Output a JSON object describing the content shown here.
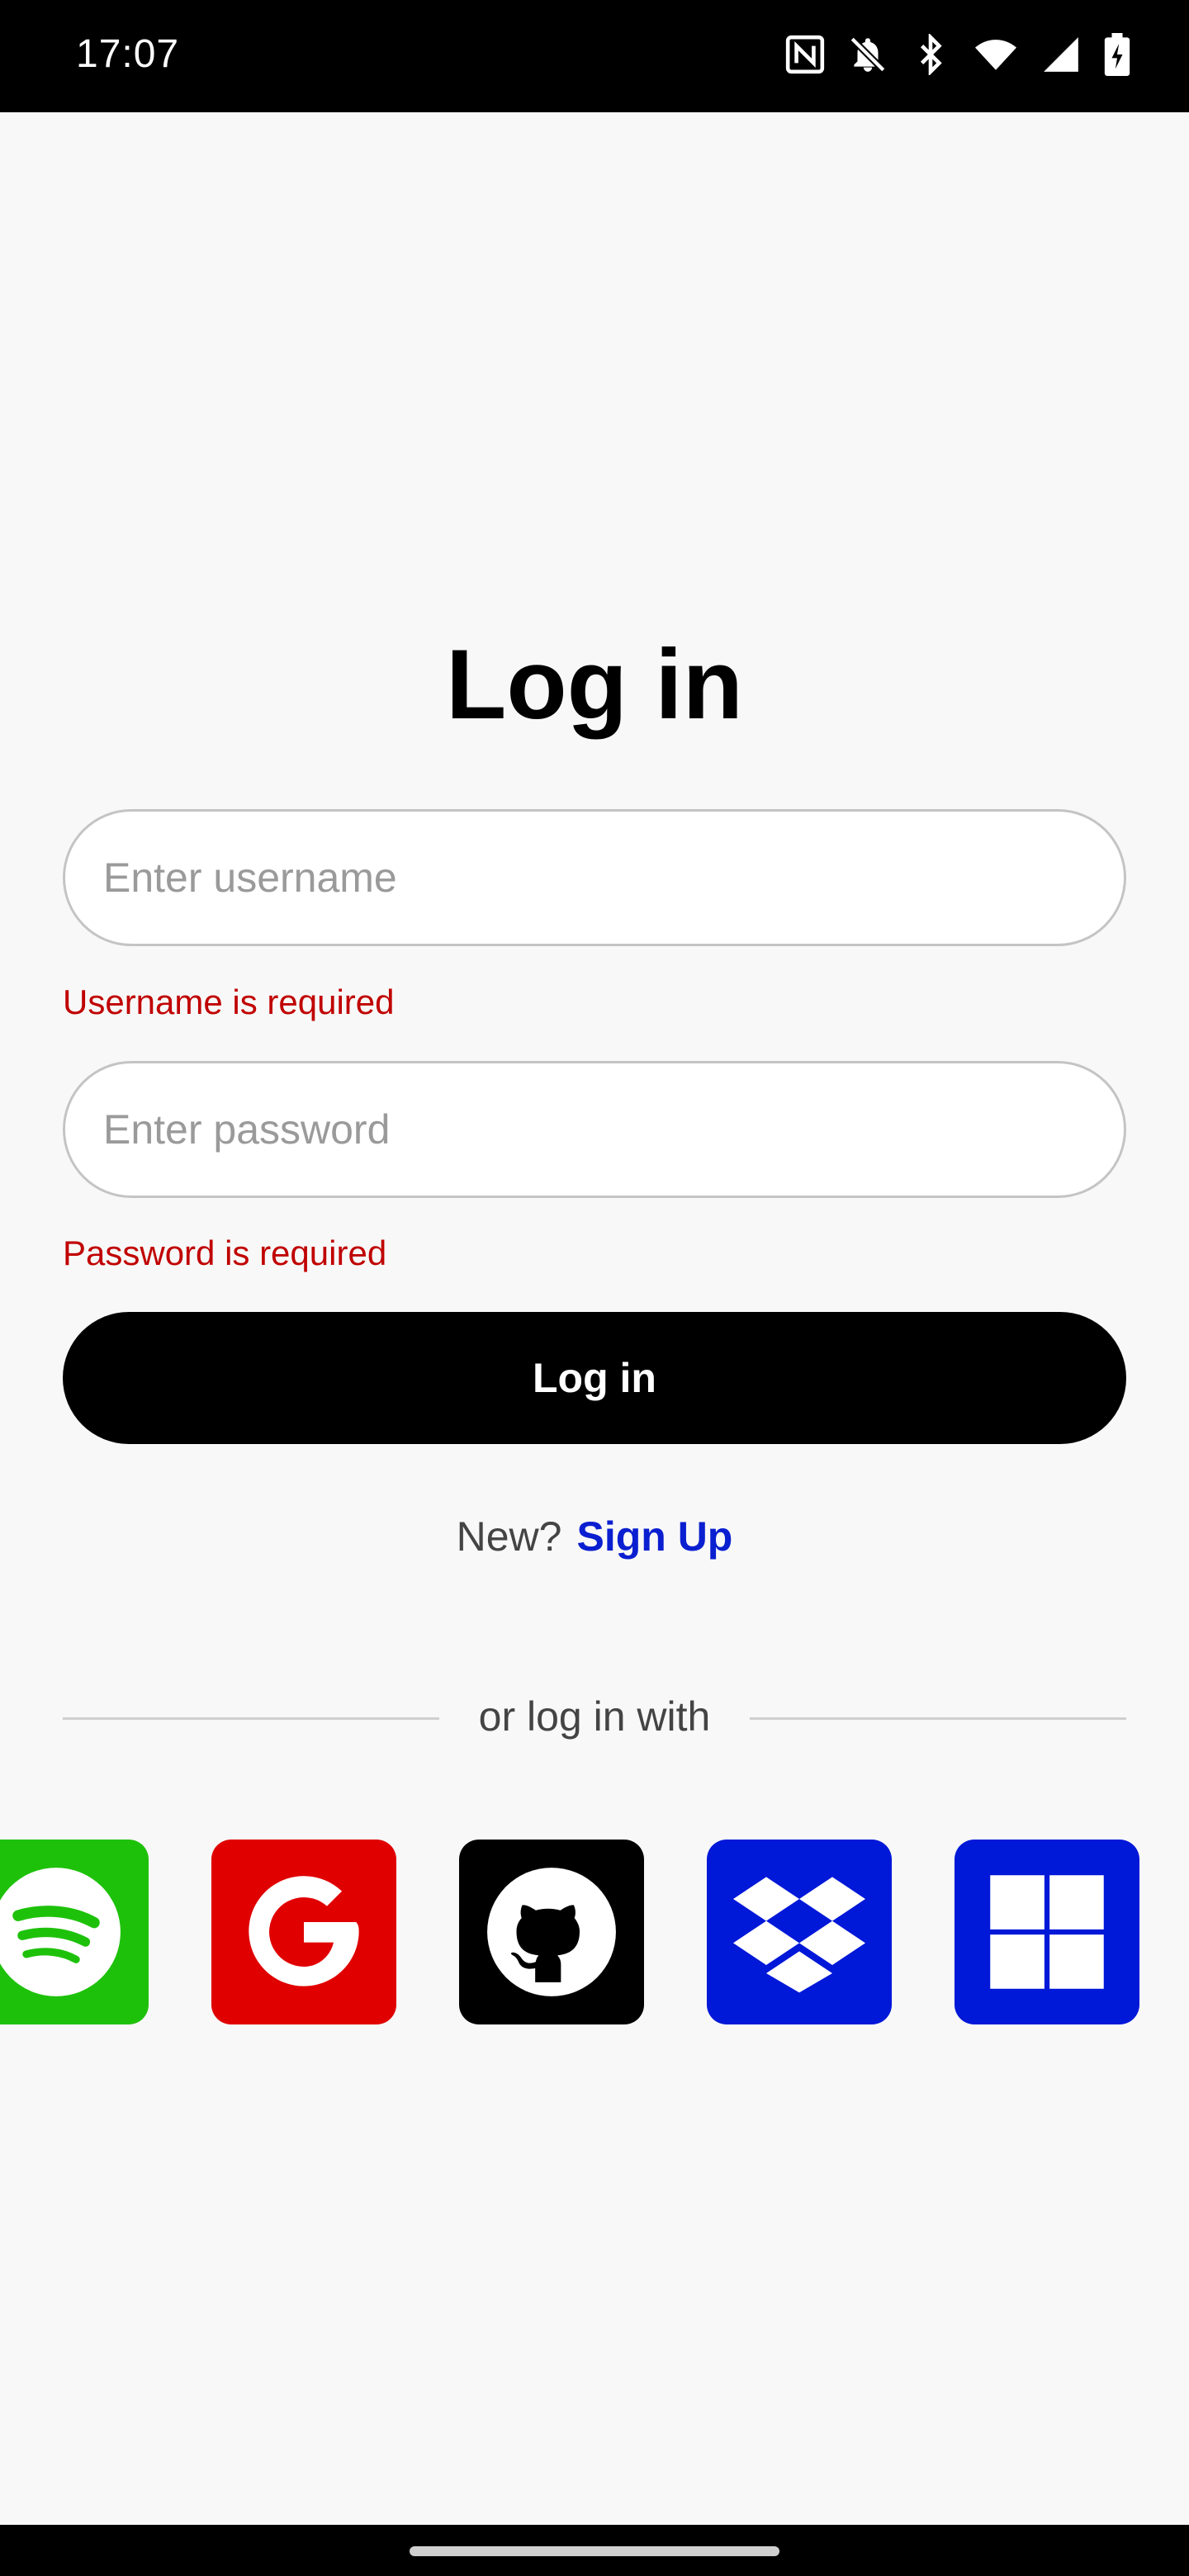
{
  "status_bar": {
    "time": "17:07",
    "icons": [
      "nfc-icon",
      "bell-off-icon",
      "bluetooth-icon",
      "wifi-icon",
      "signal-icon",
      "battery-charging-icon"
    ]
  },
  "login": {
    "title": "Log in",
    "username": {
      "value": "",
      "placeholder": "Enter username",
      "error": "Username is required"
    },
    "password": {
      "value": "",
      "placeholder": "Enter password",
      "error": "Password is required"
    },
    "submit_label": "Log in",
    "signup_prompt": "New?",
    "signup_link": "Sign Up",
    "divider_text": "or log in with"
  },
  "social_providers": [
    {
      "name": "Spotify",
      "icon": "spotify-icon",
      "color": "#1ec10a"
    },
    {
      "name": "Google",
      "icon": "google-icon",
      "color": "#e00000"
    },
    {
      "name": "GitHub",
      "icon": "github-icon",
      "color": "#000000"
    },
    {
      "name": "Dropbox",
      "icon": "dropbox-icon",
      "color": "#0018d8"
    },
    {
      "name": "Microsoft",
      "icon": "microsoft-icon",
      "color": "#0018d8"
    }
  ],
  "colors": {
    "error": "#c00000",
    "link": "#0a1fd0",
    "button": "#000000",
    "background": "#f8f8f8"
  }
}
